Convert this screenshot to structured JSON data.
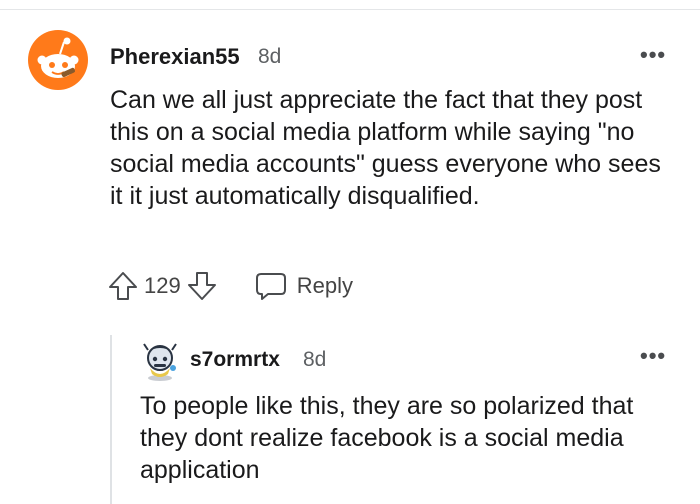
{
  "comment": {
    "author": "Pherexian55",
    "age": "8d",
    "more": "•••",
    "text": "Can we all just appreciate the fact that they post this on a social media platform while saying \"no social media accounts\" guess everyone who sees it it just automatically disqualified.",
    "score": "129",
    "reply_label": "Reply"
  },
  "reply": {
    "author": "s7ormrtx",
    "age": "8d",
    "more": "•••",
    "text": "To people like this, they are so polarized that they dont realize facebook is a social media application"
  },
  "icons": [
    "reddit-snoo-avatar",
    "user-avatar",
    "more-options-icon",
    "upvote-arrow-icon",
    "downvote-arrow-icon",
    "reply-bubble-icon"
  ],
  "colors": {
    "avatar_orange": "#ff7a1a",
    "thread_line": "#dfe2e5",
    "meta_gray": "#5d6063"
  }
}
